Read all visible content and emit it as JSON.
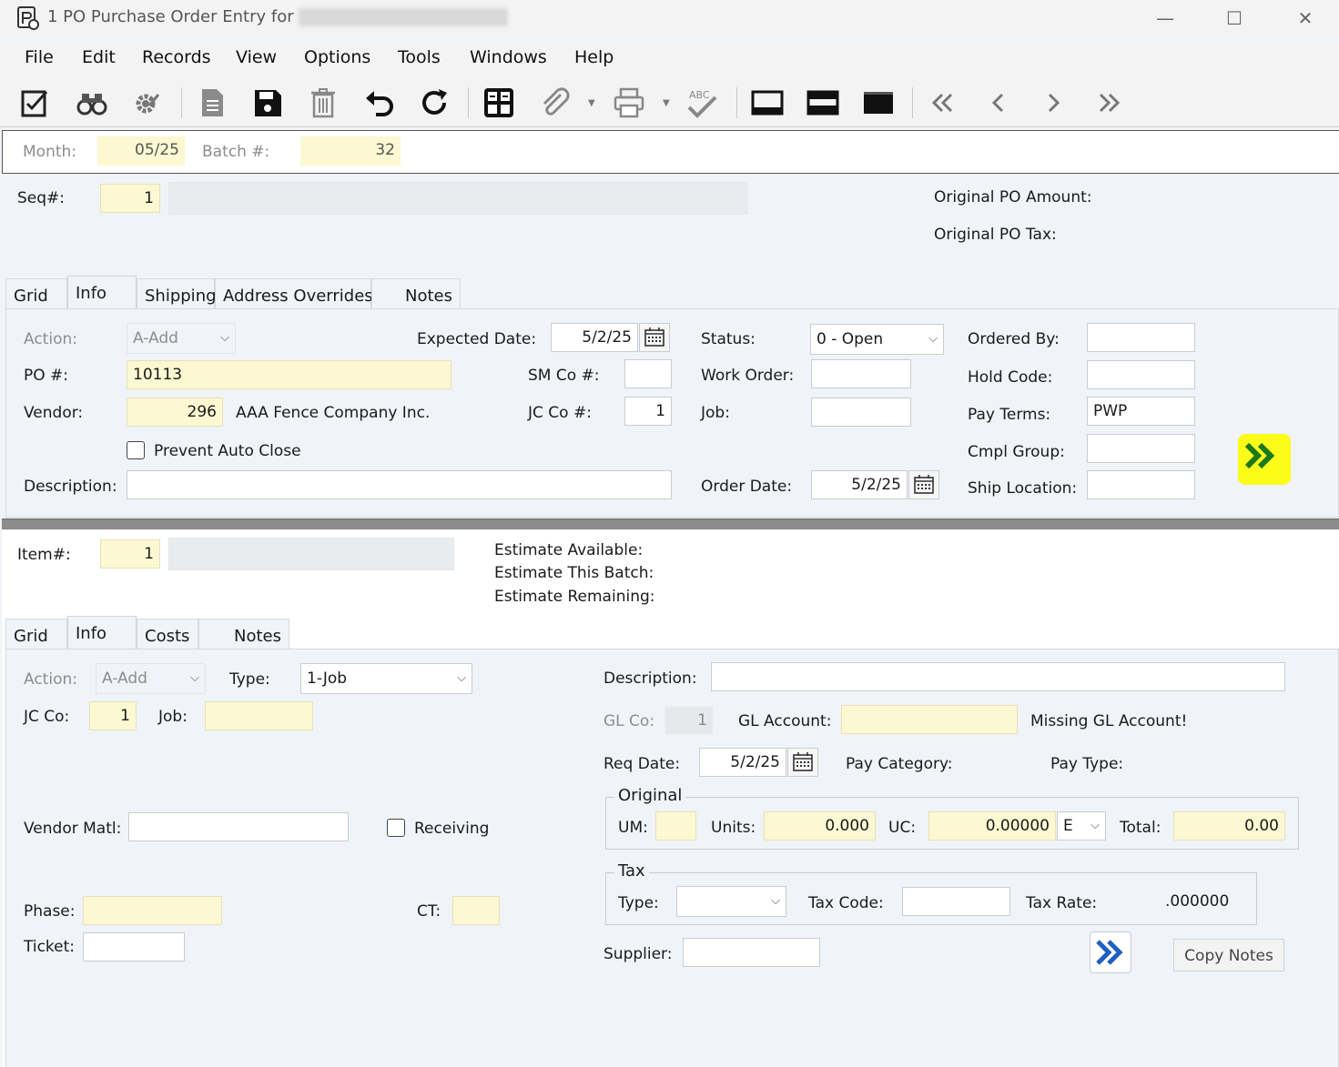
{
  "window": {
    "title": "1 PO Purchase Order Entry for",
    "minimize": "—",
    "maximize": "☐",
    "close": "✕"
  },
  "menu": [
    "File",
    "Edit",
    "Records",
    "View",
    "Options",
    "Tools",
    "Windows",
    "Help"
  ],
  "toolbar_icons": [
    "edit-icon",
    "find-icon",
    "settings-icon",
    "new-record-icon",
    "save-icon",
    "delete-icon",
    "undo-icon",
    "refresh-icon",
    "calculator-icon",
    "attachment-icon",
    "print-icon",
    "spellcheck-icon",
    "layout-bottom-icon",
    "layout-split-icon",
    "layout-top-icon",
    "first-record-icon",
    "previous-record-icon",
    "next-record-icon",
    "last-record-icon"
  ],
  "batch": {
    "month_label": "Month:",
    "month_value": "05/25",
    "batch_label": "Batch #:",
    "batch_value": "32"
  },
  "header": {
    "seq_label": "Seq#:",
    "seq_value": "1",
    "original_po_amount_label": "Original PO Amount:",
    "original_po_tax_label": "Original PO Tax:"
  },
  "header_tabs": [
    "Grid",
    "Info",
    "Shipping",
    "Address Overrides",
    "Notes"
  ],
  "header_active_tab": "Info",
  "po_info": {
    "action_label": "Action:",
    "action_value": "A-Add",
    "expected_date_label": "Expected Date:",
    "expected_date_value": "5/2/25",
    "status_label": "Status:",
    "status_value": "0 - Open",
    "ordered_by_label": "Ordered By:",
    "ordered_by_value": "",
    "po_label": "PO #:",
    "po_value": "10113",
    "sm_co_label": "SM Co #:",
    "sm_co_value": "",
    "work_order_label": "Work Order:",
    "work_order_value": "",
    "hold_code_label": "Hold Code:",
    "hold_code_value": "",
    "vendor_label": "Vendor:",
    "vendor_value": "296",
    "vendor_name": "AAA Fence Company Inc.",
    "jc_co_label": "JC Co #:",
    "jc_co_value": "1",
    "job_label": "Job:",
    "job_value": "",
    "pay_terms_label": "Pay Terms:",
    "pay_terms_value": "PWP",
    "prevent_auto_close_label": "Prevent Auto Close",
    "prevent_auto_close_checked": false,
    "cmpl_group_label": "Cmpl Group:",
    "cmpl_group_value": "",
    "description_label": "Description:",
    "description_value": "",
    "order_date_label": "Order Date:",
    "order_date_value": "5/2/25",
    "ship_location_label": "Ship Location:",
    "ship_location_value": ""
  },
  "item_header": {
    "item_label": "Item#:",
    "item_value": "1",
    "estimate_available_label": "Estimate Available:",
    "estimate_this_batch_label": "Estimate This Batch:",
    "estimate_remaining_label": "Estimate Remaining:"
  },
  "item_tabs": [
    "Grid",
    "Info",
    "Costs",
    "Notes"
  ],
  "item_active_tab": "Info",
  "item_info": {
    "action_label": "Action:",
    "action_value": "A-Add",
    "type_label": "Type:",
    "type_value": "1-Job",
    "description_label": "Description:",
    "description_value": "",
    "jc_co_label": "JC Co:",
    "jc_co_value": "1",
    "job_label": "Job:",
    "job_value": "",
    "gl_co_label": "GL Co:",
    "gl_co_value": "1",
    "gl_account_label": "GL Account:",
    "gl_account_value": "",
    "gl_warning": "Missing GL Account!",
    "req_date_label": "Req Date:",
    "req_date_value": "5/2/25",
    "pay_category_label": "Pay Category:",
    "pay_type_label": "Pay Type:",
    "vendor_matl_label": "Vendor Matl:",
    "vendor_matl_value": "",
    "receiving_label": "Receiving",
    "receiving_checked": false,
    "original_group": "Original",
    "um_label": "UM:",
    "um_value": "",
    "units_label": "Units:",
    "units_value": "0.000",
    "uc_label": "UC:",
    "uc_value": "0.00000",
    "uc_unit_value": "E",
    "total_label": "Total:",
    "total_value": "0.00",
    "tax_group": "Tax",
    "tax_type_label": "Type:",
    "tax_type_value": "",
    "tax_code_label": "Tax Code:",
    "tax_code_value": "",
    "tax_rate_label": "Tax Rate:",
    "tax_rate_value": ".000000",
    "phase_label": "Phase:",
    "phase_value": "",
    "ct_label": "CT:",
    "ct_value": "",
    "ticket_label": "Ticket:",
    "ticket_value": "",
    "supplier_label": "Supplier:",
    "supplier_value": "",
    "copy_notes_label": "Copy Notes"
  },
  "colors": {
    "required_field": "#fbf8d2",
    "panel_bg": "#f0f3f7",
    "highlight": "#fbfb1a",
    "accent_blue": "#1f5fbf",
    "accent_green": "#1a7a1a"
  }
}
